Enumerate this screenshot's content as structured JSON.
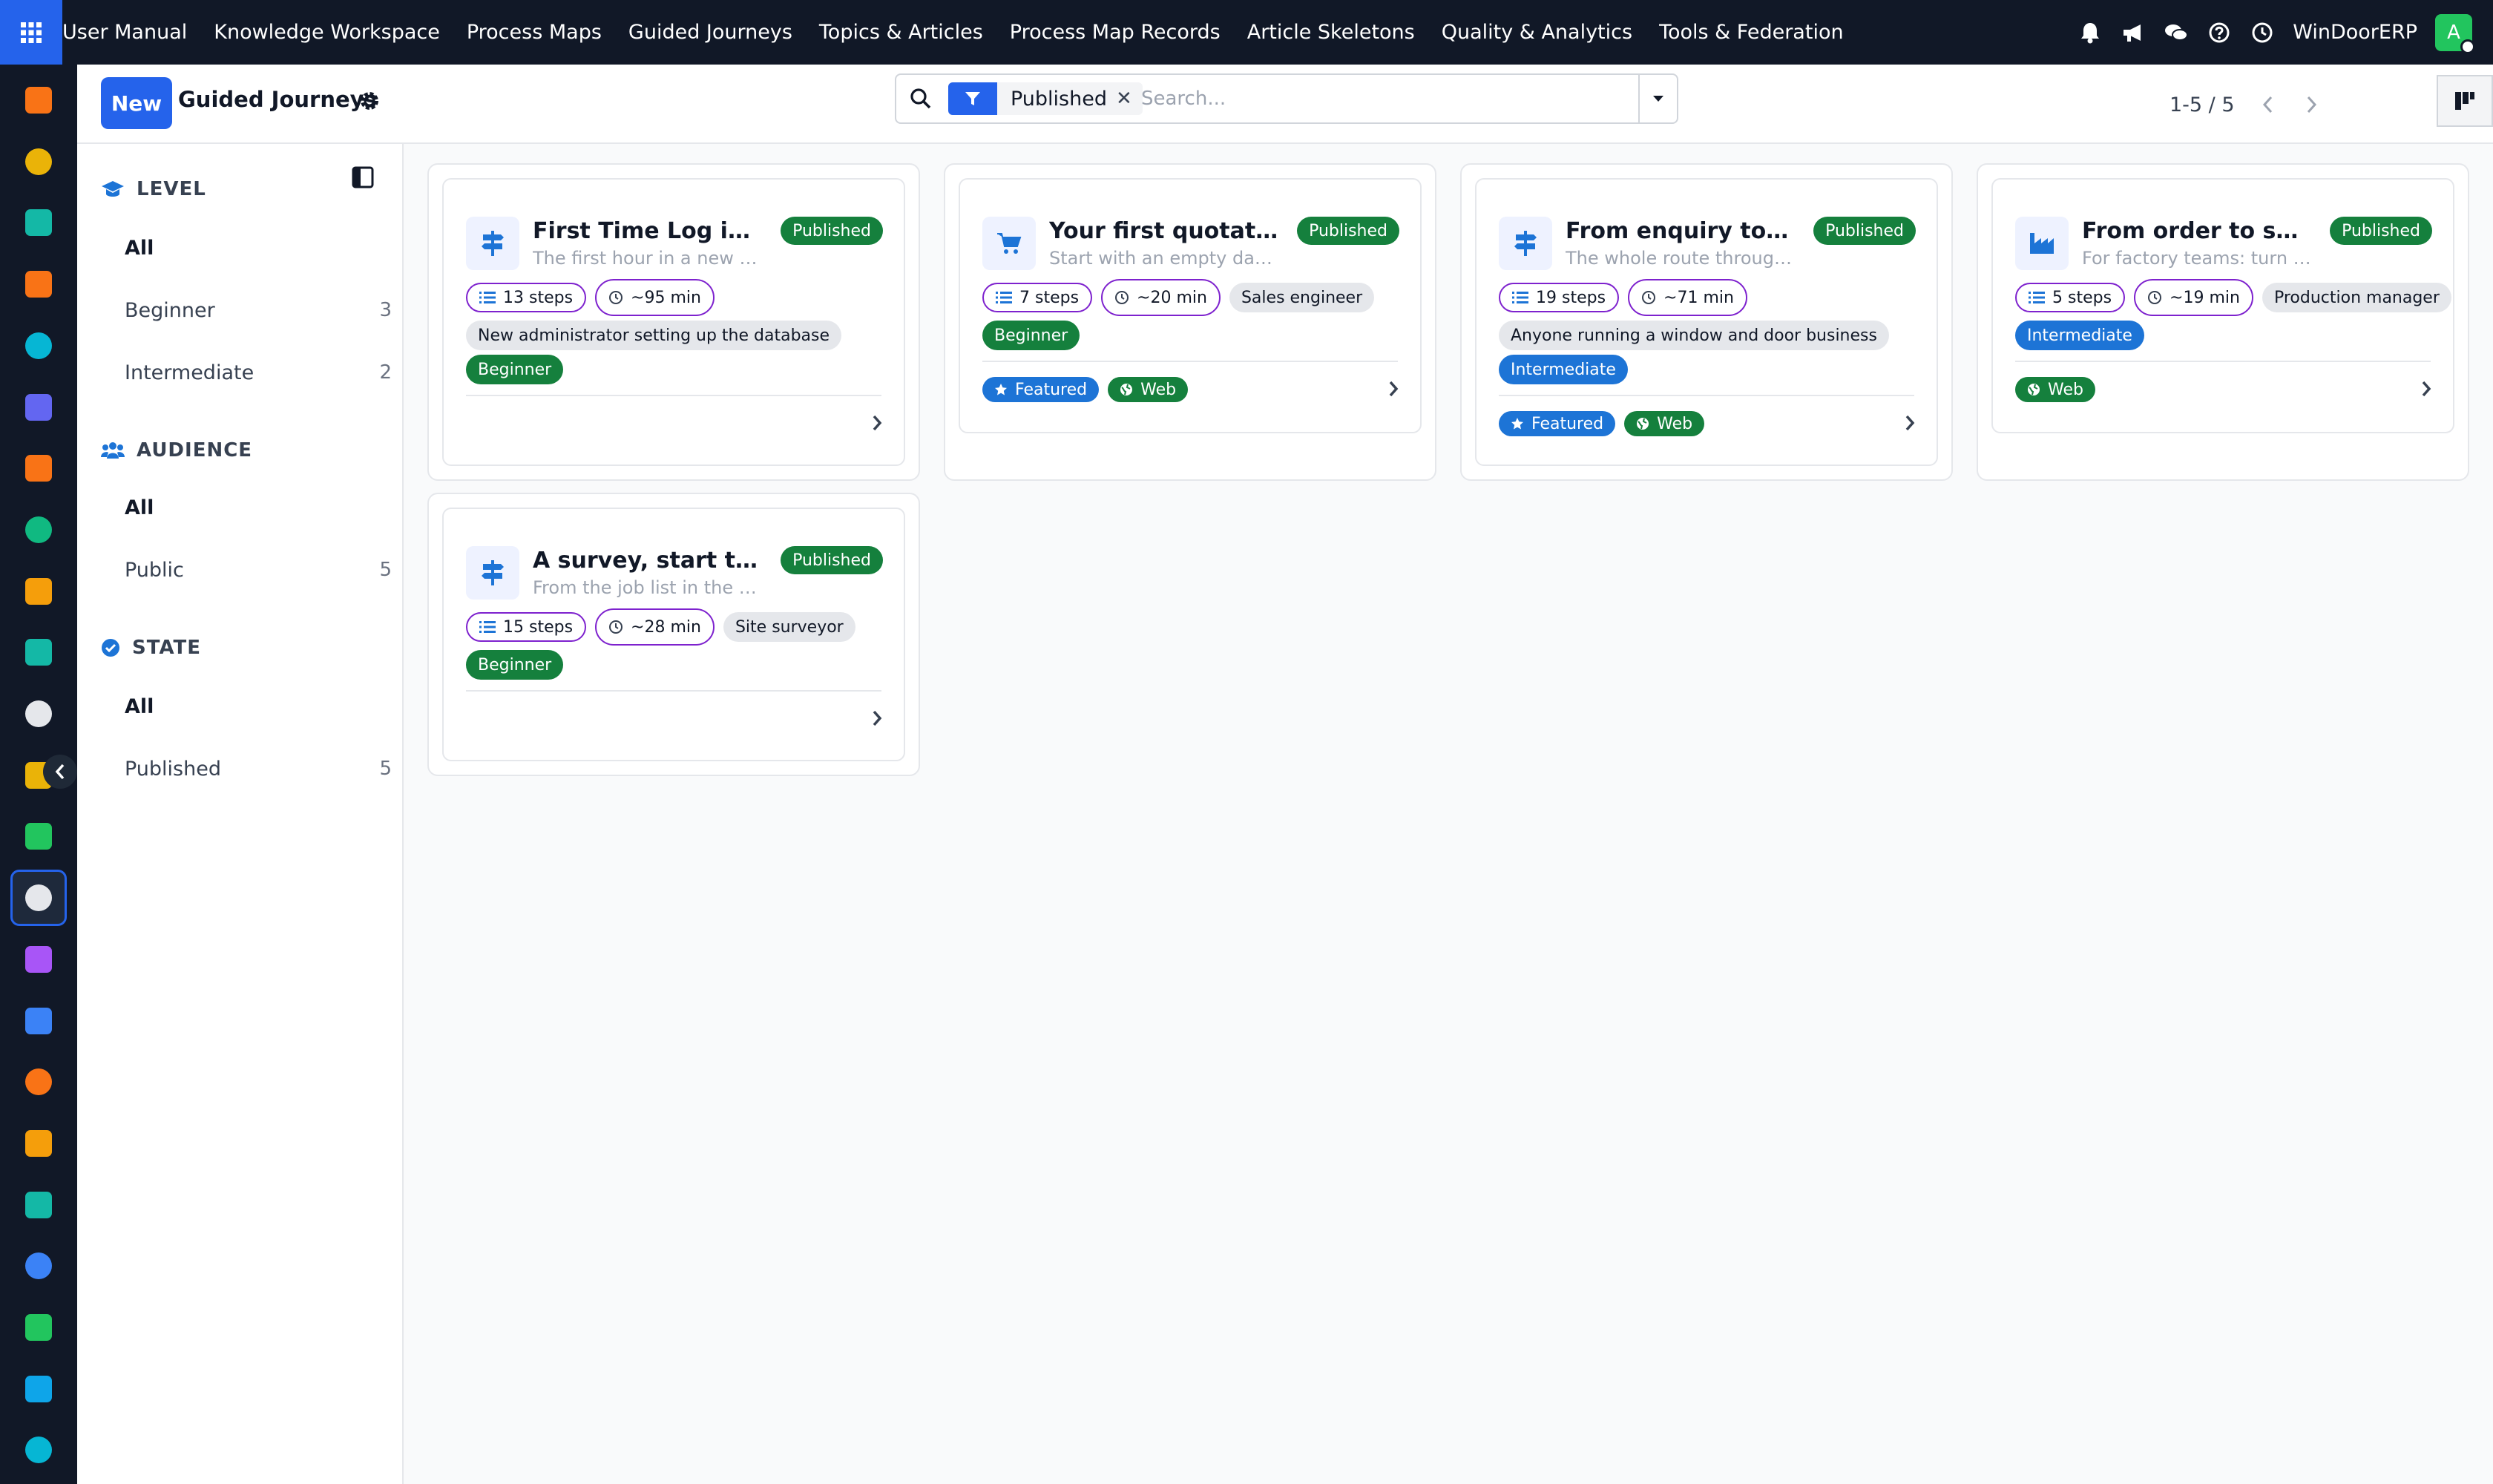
{
  "topbar": {
    "menu": [
      "User Manual",
      "Knowledge Workspace",
      "Process Maps",
      "Guided Journeys",
      "Topics & Articles",
      "Process Map Records",
      "Article Skeletons",
      "Quality & Analytics",
      "Tools & Federation"
    ],
    "company": "WinDoorERP",
    "avatar_initial": "A",
    "avatar_color": "#22c55e"
  },
  "control": {
    "new_label": "New",
    "title": "Guided Journeys",
    "facet_value": "Published",
    "search_placeholder": "Search...",
    "pager": "1-5 / 5"
  },
  "sidebar": {
    "sections": [
      {
        "title": "LEVEL",
        "icon": "graduation-cap-icon",
        "items": [
          {
            "label": "All",
            "count": ""
          },
          {
            "label": "Beginner",
            "count": "3"
          },
          {
            "label": "Intermediate",
            "count": "2"
          }
        ]
      },
      {
        "title": "AUDIENCE",
        "icon": "users-icon",
        "items": [
          {
            "label": "All",
            "count": ""
          },
          {
            "label": "Public",
            "count": "5"
          }
        ]
      },
      {
        "title": "STATE",
        "icon": "check-circle-icon",
        "items": [
          {
            "label": "All",
            "count": ""
          },
          {
            "label": "Published",
            "count": "5"
          }
        ]
      }
    ]
  },
  "cards": [
    {
      "title": "First Time Log in Sy...",
      "subtitle": "The first hour in a new Win...",
      "state": "Published",
      "icon": "signpost-icon",
      "steps": "13 steps",
      "duration": "~95 min",
      "audience": "New administrator setting up the database",
      "level": "Beginner",
      "featured": "",
      "channel": ""
    },
    {
      "title": "Your first quotation,...",
      "subtitle": "Start with an empty databa...",
      "state": "Published",
      "icon": "cart-icon",
      "steps": "7 steps",
      "duration": "~20 min",
      "audience": "Sales engineer",
      "level": "Beginner",
      "featured": "Featured",
      "channel": "Web"
    },
    {
      "title": "From enquiry to inst...",
      "subtitle": "The whole route through ...",
      "state": "Published",
      "icon": "signpost-icon",
      "steps": "19 steps",
      "duration": "~71 min",
      "audience": "Anyone running a window and door business",
      "level": "Intermediate",
      "featured": "Featured",
      "channel": "Web"
    },
    {
      "title": "From order to shop ...",
      "subtitle": "For factory teams: turn an ...",
      "state": "Published",
      "icon": "factory-icon",
      "steps": "5 steps",
      "duration": "~19 min",
      "audience": "Production manager",
      "level": "Intermediate",
      "featured": "",
      "channel": "Web"
    },
    {
      "title": "A survey, start to fin...",
      "subtitle": "From the job list in the van ...",
      "state": "Published",
      "icon": "signpost-icon",
      "steps": "15 steps",
      "duration": "~28 min",
      "audience": "Site surveyor",
      "level": "Beginner",
      "featured": "",
      "channel": ""
    }
  ],
  "colors": {
    "accent": "#2563eb",
    "published": "#15803d",
    "intermediate": "#1d74d6",
    "chip_outline": "#7e22ce"
  }
}
